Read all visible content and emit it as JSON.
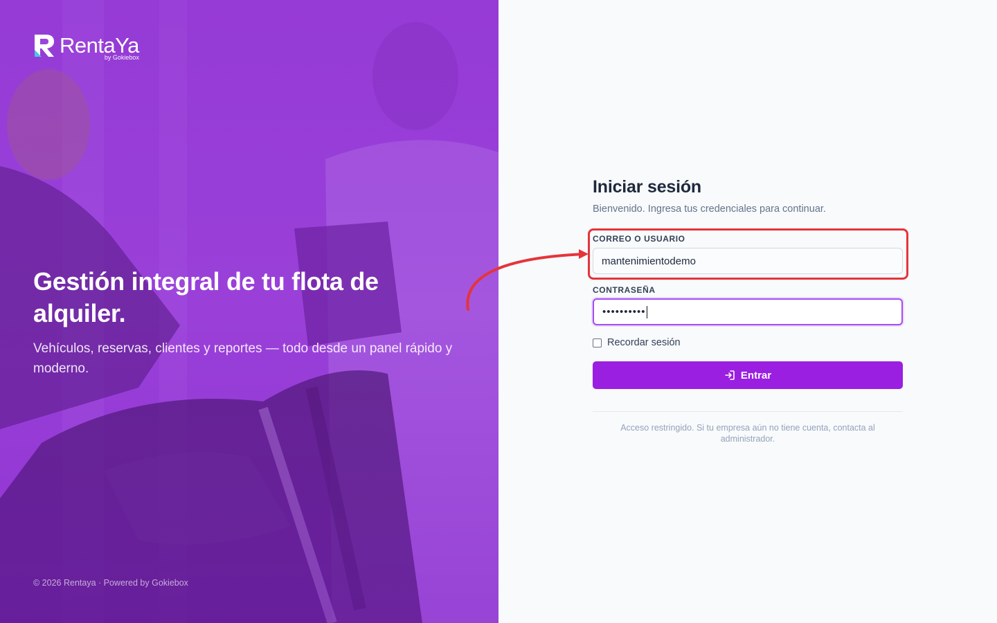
{
  "brand": {
    "name": "RentaYa",
    "byline": "by Gokiebox"
  },
  "hero": {
    "title": "Gestión integral de tu flota de alquiler.",
    "subtitle": "Vehículos, reservas, clientes y reportes — todo desde un panel rápido y moderno.",
    "footer": "© 2026 Rentaya · Powered by Gokiebox"
  },
  "login": {
    "title": "Iniciar sesión",
    "subtitle": "Bienvenido. Ingresa tus credenciales para continuar.",
    "user_label": "CORREO O USUARIO",
    "user_value": "mantenimientodemo",
    "password_label": "CONTRASEÑA",
    "password_mask": "••••••••••",
    "remember_label": "Recordar sesión",
    "remember_checked": false,
    "submit_label": "Entrar",
    "submit_icon": "login-icon",
    "note": "Acceso restringido. Si tu empresa aún no tiene cuenta, contacta al administrador."
  },
  "colors": {
    "brand_purple": "#9a1fe0",
    "focus_ring": "#a64cf0",
    "annotation_red": "#e5343a"
  }
}
